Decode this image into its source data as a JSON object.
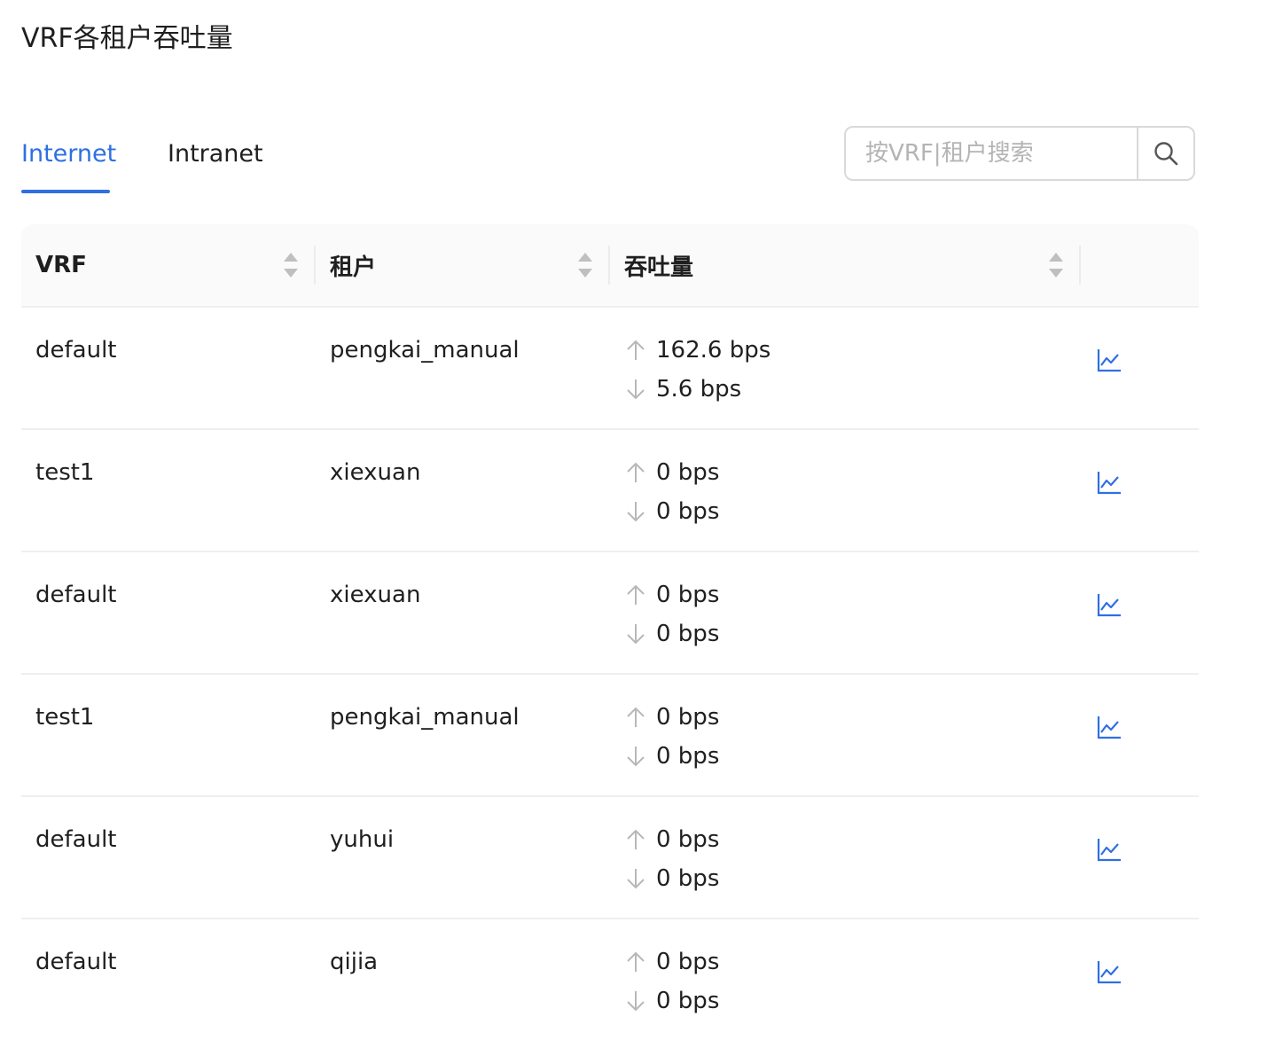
{
  "page": {
    "title": "VRF各租户吞吐量"
  },
  "tabs": [
    {
      "label": "Internet",
      "active": true
    },
    {
      "label": "Intranet",
      "active": false
    }
  ],
  "search": {
    "placeholder": "按VRF|租户搜索",
    "value": "",
    "icon": "search-icon"
  },
  "table": {
    "columns": [
      {
        "label": "VRF",
        "sortable": true
      },
      {
        "label": "租户",
        "sortable": true
      },
      {
        "label": "吞吐量",
        "sortable": true
      },
      {
        "label": "",
        "sortable": false
      }
    ],
    "rows": [
      {
        "vrf": "default",
        "tenant": "pengkai_manual",
        "up": "162.6 bps",
        "down": "5.6 bps"
      },
      {
        "vrf": "test1",
        "tenant": "xiexuan",
        "up": "0 bps",
        "down": "0 bps"
      },
      {
        "vrf": "default",
        "tenant": "xiexuan",
        "up": "0 bps",
        "down": "0 bps"
      },
      {
        "vrf": "test1",
        "tenant": "pengkai_manual",
        "up": "0 bps",
        "down": "0 bps"
      },
      {
        "vrf": "default",
        "tenant": "yuhui",
        "up": "0 bps",
        "down": "0 bps"
      },
      {
        "vrf": "default",
        "tenant": "qijia",
        "up": "0 bps",
        "down": "0 bps"
      }
    ],
    "row_action_icon": "line-chart-icon"
  },
  "colors": {
    "accent": "#2f6fe3",
    "text": "#1f1f1f",
    "muted_icon": "#b8b8b8",
    "border": "#efefef",
    "header_bg": "#fafafa"
  }
}
